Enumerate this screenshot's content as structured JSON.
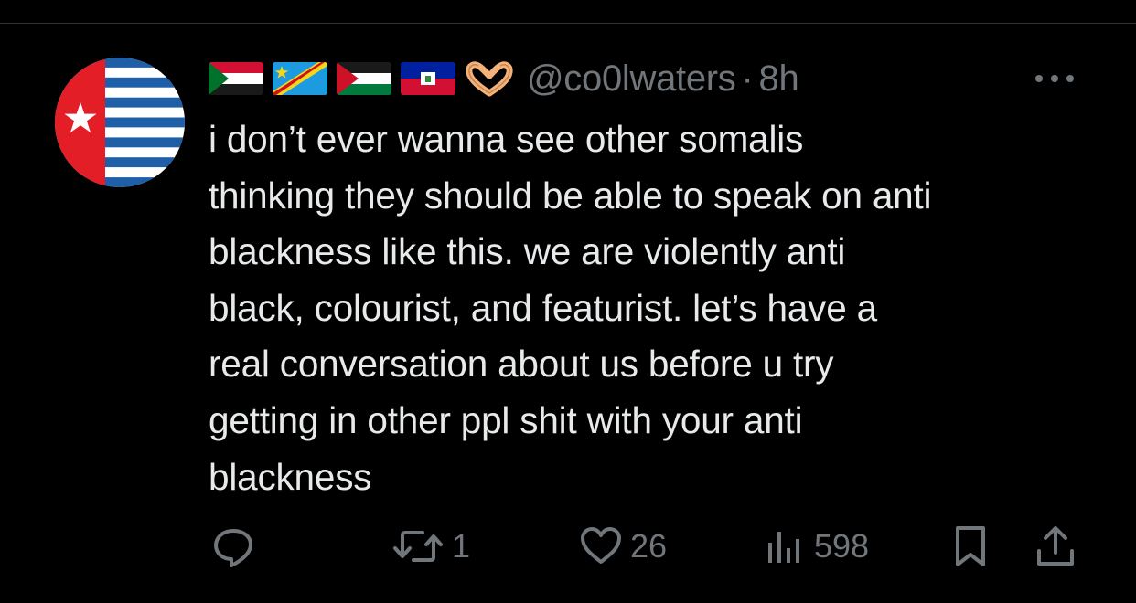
{
  "tweet": {
    "avatar": {
      "icon": "west-papua-flag-avatar"
    },
    "header_emoji": [
      "sudan-flag",
      "dr-congo-flag",
      "palestine-flag",
      "haiti-flag",
      "heart-hands-emoji"
    ],
    "handle": "@co0lwaters",
    "separator": "·",
    "time": "8h",
    "more_icon": "more-horizontal-icon",
    "text": "i don’t ever wanna see other somalis\nthinking they should be able to speak on anti\nblackness like this. we are violently anti\nblack, colourist, and featurist. let’s have a\nreal conversation about us before u try\ngetting in other ppl shit with your anti\nblackness"
  },
  "actions": {
    "reply": {
      "icon": "reply-icon",
      "count": ""
    },
    "retweet": {
      "icon": "retweet-icon",
      "count": "1"
    },
    "like": {
      "icon": "heart-icon",
      "count": "26"
    },
    "views": {
      "icon": "views-icon",
      "count": "598"
    },
    "bookmark": {
      "icon": "bookmark-icon"
    },
    "share": {
      "icon": "share-icon"
    }
  },
  "colors": {
    "background": "#000000",
    "text": "#e7e9ea",
    "secondary": "#71767b",
    "divider": "#2f3336"
  }
}
